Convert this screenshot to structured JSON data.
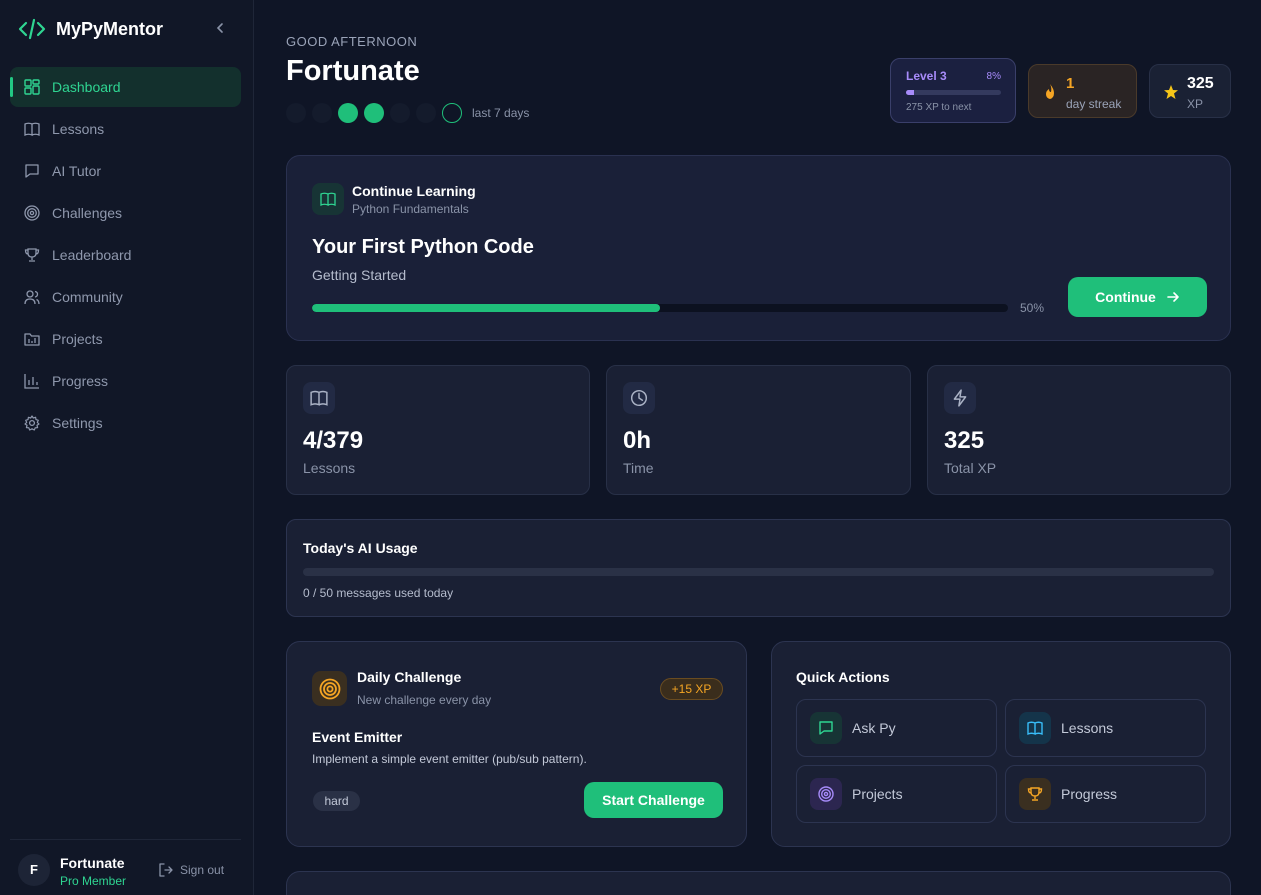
{
  "app": {
    "name": "MyPyMentor"
  },
  "sidebar": {
    "items": [
      {
        "label": "Dashboard",
        "icon": "dashboard-icon",
        "active": true
      },
      {
        "label": "Lessons",
        "icon": "book-icon"
      },
      {
        "label": "AI Tutor",
        "icon": "chat-icon"
      },
      {
        "label": "Challenges",
        "icon": "target-icon"
      },
      {
        "label": "Leaderboard",
        "icon": "trophy-icon"
      },
      {
        "label": "Community",
        "icon": "users-icon"
      },
      {
        "label": "Projects",
        "icon": "folder-icon"
      },
      {
        "label": "Progress",
        "icon": "bar-chart-icon"
      },
      {
        "label": "Settings",
        "icon": "gear-icon"
      }
    ],
    "user": {
      "initial": "F",
      "name": "Fortunate",
      "role": "Pro Member"
    },
    "signout_label": "Sign out"
  },
  "header": {
    "greeting": "GOOD AFTERNOON",
    "name": "Fortunate",
    "week_label": "last 7 days",
    "week": [
      "none",
      "none",
      "done",
      "done",
      "none",
      "none",
      "today"
    ]
  },
  "level": {
    "label": "Level 3",
    "percent_label": "8%",
    "progress": 0.08,
    "sub": "275 XP to next"
  },
  "streak": {
    "value": "1",
    "label": "day streak"
  },
  "xp": {
    "value": "325",
    "label": "XP"
  },
  "continue_card": {
    "kicker": "Continue Learning",
    "course": "Python Fundamentals",
    "lesson": "Your First Python Code",
    "section": "Getting Started",
    "progress": 0.5,
    "progress_label": "50%",
    "button": "Continue"
  },
  "stats": [
    {
      "value": "4/379",
      "label": "Lessons",
      "icon": "book-icon"
    },
    {
      "value": "0h",
      "label": "Time",
      "icon": "clock-icon"
    },
    {
      "value": "325",
      "label": "Total XP",
      "icon": "bolt-icon"
    }
  ],
  "ai_usage": {
    "title": "Today's AI Usage",
    "used": 0,
    "limit": 50,
    "text": "0 / 50 messages used today"
  },
  "daily_challenge": {
    "title": "Daily Challenge",
    "subtitle": "New challenge every day",
    "xp_badge": "+15 XP",
    "name": "Event Emitter",
    "description": "Implement a simple event emitter (pub/sub pattern).",
    "difficulty": "hard",
    "button": "Start Challenge"
  },
  "quick_actions": {
    "title": "Quick Actions",
    "items": [
      {
        "label": "Ask Py",
        "icon": "chat-icon",
        "color": "#2fd592"
      },
      {
        "label": "Lessons",
        "icon": "book-icon",
        "color": "#38bdf8"
      },
      {
        "label": "Projects",
        "icon": "target-icon",
        "color": "#a78bfa"
      },
      {
        "label": "Progress",
        "icon": "trophy-icon",
        "color": "#f5a524"
      }
    ]
  },
  "colors": {
    "accent": "#1fbf7a",
    "background": "#0f1526",
    "purple": "#a78bfa",
    "amber": "#f5a524"
  }
}
